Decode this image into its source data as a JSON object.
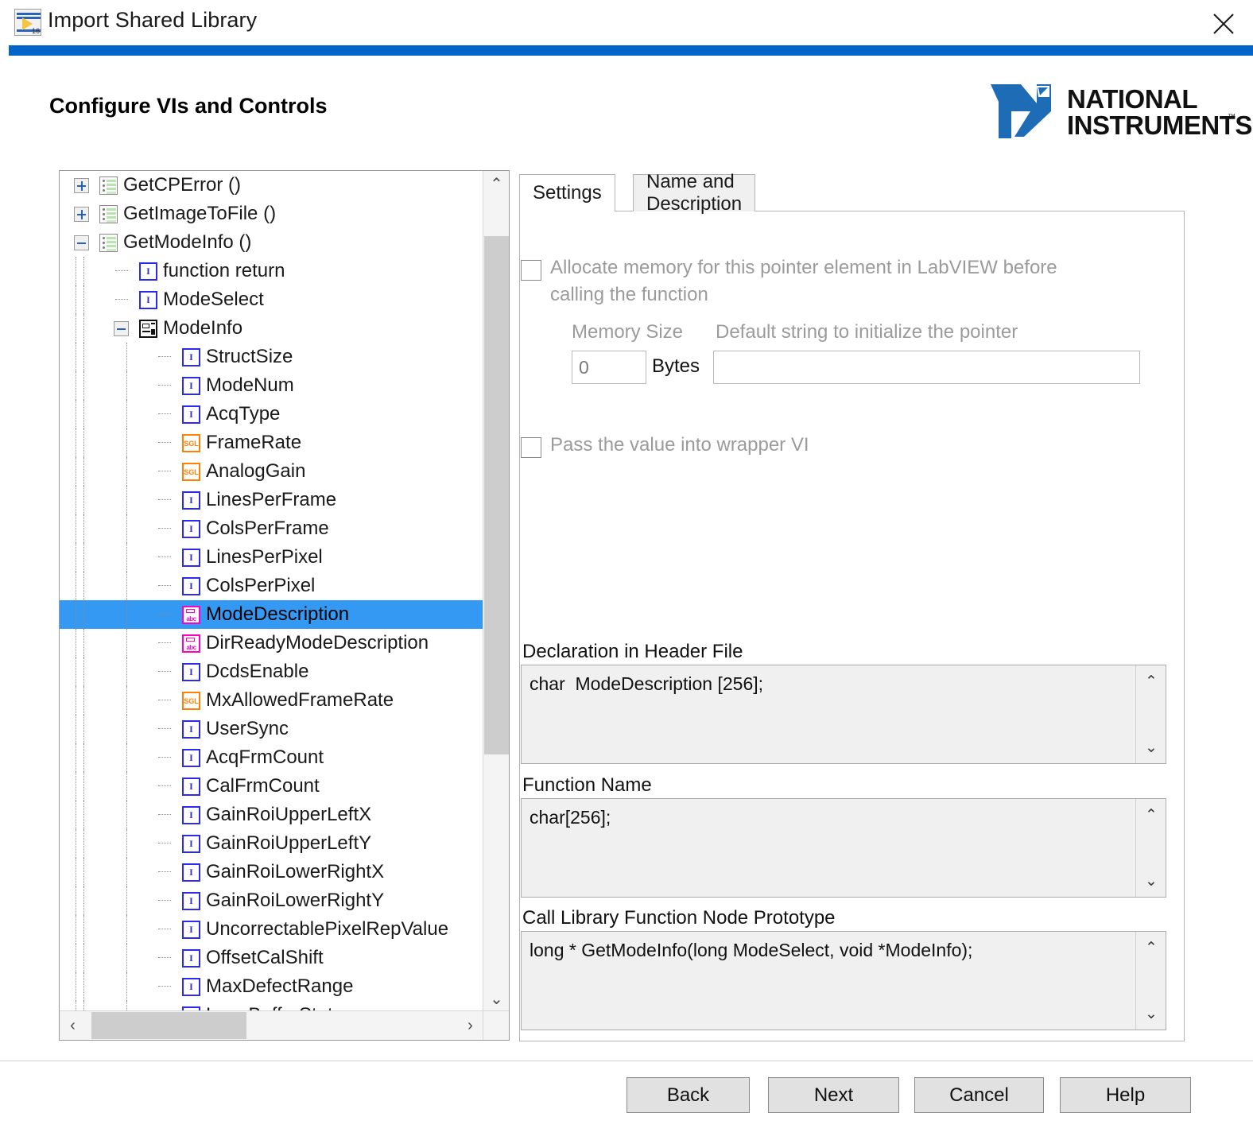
{
  "window": {
    "title": "Import Shared Library",
    "app_icon": "labview-vi-icon",
    "icon_sub": "16",
    "close_label": "✕",
    "accent_color": "#0065c8"
  },
  "header": {
    "page_title": "Configure VIs and Controls",
    "logo": {
      "line1": "NATIONAL",
      "line2": "INSTRUMENTS",
      "trademark": "™",
      "color": "#1d6cb5"
    }
  },
  "tree": {
    "selected": "ModeDescription",
    "selection_color": "#3399f3",
    "items": [
      {
        "label": "GetCPError ()",
        "icon": "vi-icon",
        "depth": 0,
        "toggle": "plus"
      },
      {
        "label": "GetImageToFile ()",
        "icon": "vi-icon",
        "depth": 0,
        "toggle": "plus"
      },
      {
        "label": "GetModeInfo ()",
        "icon": "vi-icon",
        "depth": 0,
        "toggle": "minus"
      },
      {
        "label": "function return",
        "icon": "integer-icon",
        "depth": 1,
        "toggle": "none"
      },
      {
        "label": "ModeSelect",
        "icon": "integer-icon",
        "depth": 1,
        "toggle": "none"
      },
      {
        "label": "ModeInfo",
        "icon": "cluster-icon",
        "depth": 1,
        "toggle": "minus"
      },
      {
        "label": "StructSize",
        "icon": "integer-icon",
        "depth": 2,
        "toggle": "none"
      },
      {
        "label": "ModeNum",
        "icon": "integer-icon",
        "depth": 2,
        "toggle": "none"
      },
      {
        "label": "AcqType",
        "icon": "integer-icon",
        "depth": 2,
        "toggle": "none"
      },
      {
        "label": "FrameRate",
        "icon": "single-icon",
        "depth": 2,
        "toggle": "none"
      },
      {
        "label": "AnalogGain",
        "icon": "single-icon",
        "depth": 2,
        "toggle": "none"
      },
      {
        "label": "LinesPerFrame",
        "icon": "integer-icon",
        "depth": 2,
        "toggle": "none"
      },
      {
        "label": "ColsPerFrame",
        "icon": "integer-icon",
        "depth": 2,
        "toggle": "none"
      },
      {
        "label": "LinesPerPixel",
        "icon": "integer-icon",
        "depth": 2,
        "toggle": "none"
      },
      {
        "label": "ColsPerPixel",
        "icon": "integer-icon",
        "depth": 2,
        "toggle": "none"
      },
      {
        "label": "ModeDescription",
        "icon": "string-icon",
        "depth": 2,
        "toggle": "none"
      },
      {
        "label": "DirReadyModeDescription",
        "icon": "string-icon",
        "depth": 2,
        "toggle": "none"
      },
      {
        "label": "DcdsEnable",
        "icon": "integer-icon",
        "depth": 2,
        "toggle": "none"
      },
      {
        "label": "MxAllowedFrameRate",
        "icon": "single-icon",
        "depth": 2,
        "toggle": "none"
      },
      {
        "label": "UserSync",
        "icon": "integer-icon",
        "depth": 2,
        "toggle": "none"
      },
      {
        "label": "AcqFrmCount",
        "icon": "integer-icon",
        "depth": 2,
        "toggle": "none"
      },
      {
        "label": "CalFrmCount",
        "icon": "integer-icon",
        "depth": 2,
        "toggle": "none"
      },
      {
        "label": "GainRoiUpperLeftX",
        "icon": "integer-icon",
        "depth": 2,
        "toggle": "none"
      },
      {
        "label": "GainRoiUpperLeftY",
        "icon": "integer-icon",
        "depth": 2,
        "toggle": "none"
      },
      {
        "label": "GainRoiLowerRightX",
        "icon": "integer-icon",
        "depth": 2,
        "toggle": "none"
      },
      {
        "label": "GainRoiLowerRightY",
        "icon": "integer-icon",
        "depth": 2,
        "toggle": "none"
      },
      {
        "label": "UncorrectablePixelRepValue",
        "icon": "integer-icon",
        "depth": 2,
        "toggle": "none"
      },
      {
        "label": "OffsetCalShift",
        "icon": "integer-icon",
        "depth": 2,
        "toggle": "none"
      },
      {
        "label": "MaxDefectRange",
        "icon": "integer-icon",
        "depth": 2,
        "toggle": "none"
      },
      {
        "label": "LoopBufferStatus",
        "icon": "integer-icon",
        "depth": 2,
        "toggle": "none"
      }
    ],
    "icon_glyphs": {
      "integer-icon": "I",
      "single-icon": "SGL",
      "string-icon": "abc"
    }
  },
  "tabs": {
    "settings": "Settings",
    "name_and_description": "Name and Description",
    "active": "Settings"
  },
  "settings": {
    "allocate_checkbox": {
      "label": "Allocate memory for this pointer element in LabVIEW before calling the function",
      "checked": false,
      "enabled": false
    },
    "memory_size_label": "Memory Size",
    "memory_size_value": "0",
    "bytes_label": "Bytes",
    "default_string_label": "Default string to initialize the pointer",
    "default_string_value": "",
    "pass_value_checkbox": {
      "label": "Pass the value into wrapper VI",
      "checked": false,
      "enabled": false
    },
    "declaration_label": "Declaration in Header File",
    "declaration_value": "char  ModeDescription [256];",
    "function_name_label": "Function Name",
    "function_name_value": "char[256];",
    "prototype_label": "Call Library Function Node Prototype",
    "prototype_value": "long * GetModeInfo(long ModeSelect, void *ModeInfo);"
  },
  "scrollbars": {
    "up_arrow": "⌃",
    "down_arrow": "⌄",
    "left_arrow": "‹",
    "right_arrow": "›",
    "text_up": "⌃",
    "text_down": "⌄"
  },
  "footer": {
    "back": "Back",
    "next": "Next",
    "cancel": "Cancel",
    "help": "Help"
  }
}
